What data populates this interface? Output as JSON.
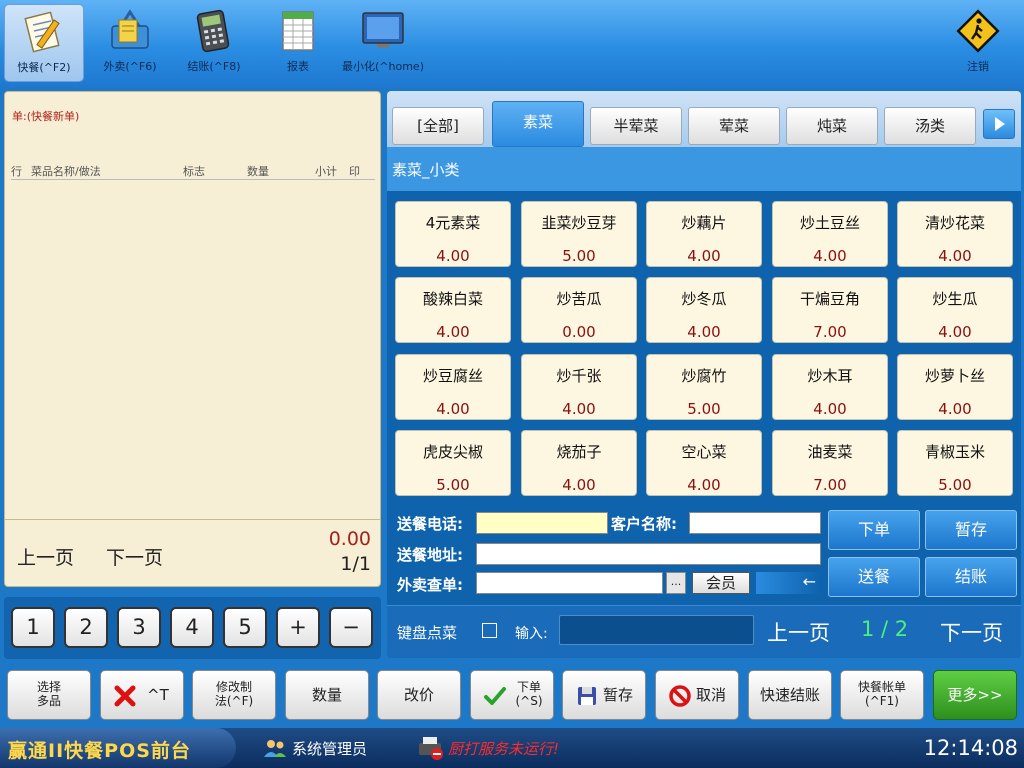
{
  "toolbar": {
    "items": [
      {
        "label": "快餐(^F2)",
        "icon": "notepad-pen-icon"
      },
      {
        "label": "外卖(^F6)",
        "icon": "shopping-basket-icon"
      },
      {
        "label": "结账(^F8)",
        "icon": "pos-terminal-icon"
      },
      {
        "label": "报表",
        "icon": "spreadsheet-icon"
      },
      {
        "label": "最小化(^home)",
        "icon": "monitor-icon"
      }
    ],
    "logout_label": "注销"
  },
  "order": {
    "title": "单:(快餐新单)",
    "columns": [
      "行",
      "菜品名称/做法",
      "标志",
      "数量",
      "小计",
      "印"
    ],
    "prev_label": "上一页",
    "next_label": "下一页",
    "total": "0.00",
    "page": "1/1"
  },
  "numpad": [
    "1",
    "2",
    "3",
    "4",
    "5",
    "+",
    "−"
  ],
  "menu": {
    "tabs": [
      "[全部]",
      "素菜",
      "半荤菜",
      "荤菜",
      "炖菜",
      "汤类"
    ],
    "active_tab": 1,
    "subcategory": "素菜_小类",
    "dishes": [
      {
        "name": "4元素菜",
        "price": "4.00"
      },
      {
        "name": "韭菜炒豆芽",
        "price": "5.00"
      },
      {
        "name": "炒藕片",
        "price": "4.00"
      },
      {
        "name": "炒土豆丝",
        "price": "4.00"
      },
      {
        "name": "清炒花菜",
        "price": "4.00"
      },
      {
        "name": "酸辣白菜",
        "price": "4.00"
      },
      {
        "name": "炒苦瓜",
        "price": "0.00"
      },
      {
        "name": "炒冬瓜",
        "price": "4.00"
      },
      {
        "name": "干煸豆角",
        "price": "7.00"
      },
      {
        "name": "炒生瓜",
        "price": "4.00"
      },
      {
        "name": "炒豆腐丝",
        "price": "4.00"
      },
      {
        "name": "炒千张",
        "price": "4.00"
      },
      {
        "name": "炒腐竹",
        "price": "5.00"
      },
      {
        "name": "炒木耳",
        "price": "4.00"
      },
      {
        "name": "炒萝卜丝",
        "price": "4.00"
      },
      {
        "name": "虎皮尖椒",
        "price": "5.00"
      },
      {
        "name": "烧茄子",
        "price": "4.00"
      },
      {
        "name": "空心菜",
        "price": "4.00"
      },
      {
        "name": "油麦菜",
        "price": "7.00"
      },
      {
        "name": "青椒玉米",
        "price": "5.00"
      }
    ]
  },
  "delivery": {
    "phone_label": "送餐电话:",
    "phone_value": "",
    "customer_label": "客户名称:",
    "customer_value": "",
    "address_label": "送餐地址:",
    "address_value": "",
    "lookup_label": "外卖查单:",
    "lookup_value": "",
    "lookup_button": "...",
    "member_button": "会员",
    "enter_key": "←",
    "actions": [
      "下单",
      "暂存",
      "送餐",
      "结账"
    ]
  },
  "keyboard": {
    "label": "键盘点菜",
    "input_label": "输入:",
    "input_value": "",
    "prev_label": "上一页",
    "page": "1 / 2",
    "next_label": "下一页"
  },
  "functions": {
    "select_multi": "选择\n多品",
    "delete": "^T",
    "modify": "修改制\n法(^F)",
    "quantity": "数量",
    "change_price": "改价",
    "order": "下单\n(^S)",
    "hold": "暂存",
    "cancel": "取消",
    "quick_checkout": "快速结账",
    "quick_bill": "快餐帐单\n(^F1)",
    "more": "更多>>"
  },
  "status": {
    "brand": "赢通II快餐POS前台",
    "user": "系统管理员",
    "warning": "厨打服务未运行!",
    "time": "12:14:08"
  },
  "colors": {
    "primary_blue": "#1e78c8",
    "dark_blue": "#0f63ad",
    "price_red": "#8b0f0f",
    "page_green": "#4cf07b",
    "warning_red": "#ff2a2a",
    "clock_white": "#ffffff",
    "more_green": "#2d8f1d"
  }
}
